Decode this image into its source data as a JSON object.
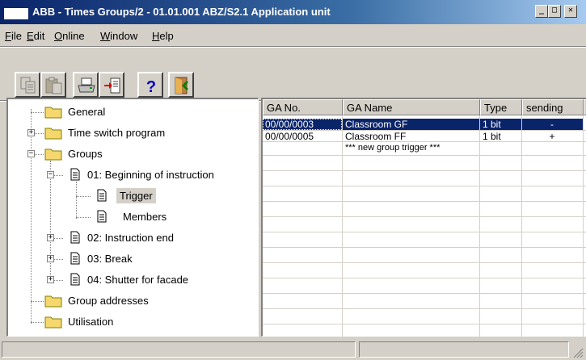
{
  "window": {
    "title": "ABB - Times Groups/2 - 01.01.001 ABZ/S2.1 Application unit",
    "minimize": "_",
    "maximize": "□",
    "close": "✕"
  },
  "menu": {
    "file": {
      "underlined": "F",
      "rest": "ile"
    },
    "edit": {
      "underlined": "E",
      "rest": "dit"
    },
    "online": {
      "underlined": "O",
      "rest": "nline"
    },
    "window": {
      "underlined": "W",
      "rest": "indow"
    },
    "help": {
      "underlined": "H",
      "rest": "elp"
    }
  },
  "toolbar": {
    "icons": [
      "copy-icon",
      "paste-icon",
      "print-icon",
      "import-icon",
      "help-icon",
      "exit-icon"
    ],
    "help_glyph": "?"
  },
  "tree": {
    "general": "General",
    "time_switch_program": "Time switch program",
    "groups": "Groups",
    "group_01": "01: Beginning of instruction",
    "trigger": "Trigger",
    "members": "Members",
    "group_02": "02: Instruction end",
    "group_03": "03: Break",
    "group_04": "04: Shutter for facade",
    "group_addresses": "Group addresses",
    "utilisation": "Utilisation",
    "plus": "+",
    "minus": "−"
  },
  "grid": {
    "headers": {
      "ga_no": "GA No.",
      "ga_name": "GA Name",
      "type": "Type",
      "sending": "sending"
    },
    "rows": [
      {
        "ga_no": "00/00/0003",
        "ga_name": "Classroom GF",
        "type": "1 bit",
        "sending": "-"
      },
      {
        "ga_no": "00/00/0005",
        "ga_name": "Classroom FF",
        "type": "1 bit",
        "sending": "+"
      },
      {
        "ga_no": "",
        "ga_name": "*** new group trigger ***",
        "type": "",
        "sending": ""
      }
    ]
  },
  "colors": {
    "titlebar": "#0a246a",
    "face": "#d4d0c8",
    "selection": "#0a246a",
    "folder": "#f5d76e"
  }
}
